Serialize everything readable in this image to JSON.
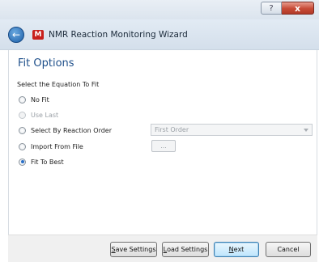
{
  "window": {
    "help_glyph": "?",
    "close_glyph": "x"
  },
  "header": {
    "back_glyph": "←",
    "logo_glyph": "M",
    "title": "NMR Reaction Monitoring Wizard"
  },
  "main": {
    "section_title": "Fit Options",
    "subheading": "Select the Equation To Fit",
    "options": [
      {
        "label": "No Fit",
        "checked": false,
        "enabled": true
      },
      {
        "label": "Use Last",
        "checked": false,
        "enabled": false
      },
      {
        "label": "Select By Reaction Order",
        "checked": false,
        "enabled": true
      },
      {
        "label": "Import From File",
        "checked": false,
        "enabled": true
      },
      {
        "label": "Fit To Best",
        "checked": true,
        "enabled": true
      }
    ],
    "order_dropdown": {
      "value": "First Order",
      "enabled": false
    },
    "browse_button": {
      "label": "...",
      "enabled": false
    }
  },
  "footer": {
    "save_settings": {
      "mnemonic": "S",
      "rest": "ave Settings"
    },
    "load_settings": {
      "mnemonic": "L",
      "rest": "oad Settings"
    },
    "next": {
      "mnemonic": "N",
      "rest": "ext"
    },
    "cancel": {
      "label": "Cancel"
    }
  }
}
